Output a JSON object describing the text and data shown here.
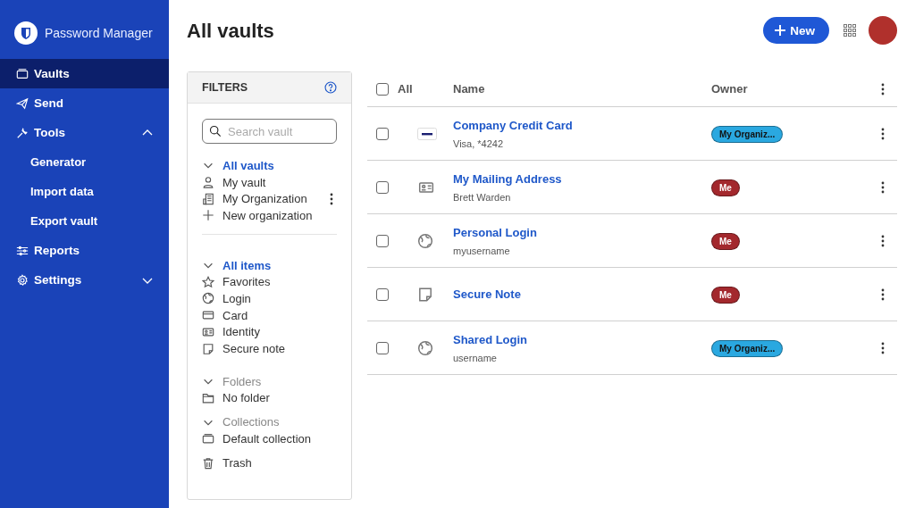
{
  "app": {
    "name": "Password Manager"
  },
  "nav": [
    {
      "label": "Vaults",
      "kind": "link",
      "selected": true
    },
    {
      "label": "Send",
      "kind": "link",
      "selected": false
    },
    {
      "label": "Tools",
      "kind": "group",
      "selected": false,
      "expanded": true,
      "children": [
        {
          "label": "Generator"
        },
        {
          "label": "Import data"
        },
        {
          "label": "Export vault"
        }
      ]
    },
    {
      "label": "Reports",
      "kind": "link",
      "selected": false
    },
    {
      "label": "Settings",
      "kind": "group",
      "selected": false,
      "expanded": false
    }
  ],
  "page": {
    "title": "All vaults",
    "new_button": "New"
  },
  "filters": {
    "title": "FILTERS",
    "search": {
      "placeholder": "Search vault"
    },
    "groups": [
      {
        "heading": "All vaults",
        "selected": true,
        "expanded": true,
        "items": [
          {
            "label": "My vault",
            "menu": false
          },
          {
            "label": "My Organization",
            "menu": true
          },
          {
            "label": "New organization",
            "menu": false
          }
        ]
      },
      {
        "heading": "All items",
        "selected": true,
        "expanded": true,
        "items": [
          {
            "label": "Favorites"
          },
          {
            "label": "Login"
          },
          {
            "label": "Card"
          },
          {
            "label": "Identity"
          },
          {
            "label": "Secure note"
          }
        ]
      },
      {
        "heading": "Folders",
        "selected": false,
        "expanded": true,
        "items": [
          {
            "label": "No folder"
          }
        ]
      },
      {
        "heading": "Collections",
        "selected": false,
        "expanded": true,
        "items": [
          {
            "label": "Default collection"
          }
        ]
      }
    ],
    "trash": "Trash"
  },
  "table": {
    "columns": [
      "All",
      "Name",
      "Owner"
    ],
    "all_checked": false,
    "rows": [
      {
        "kind": "card",
        "name": "Company Credit Card",
        "subtitle": "Visa, *4242",
        "owner": "My Organiz...",
        "color": "#2aa8e0",
        "checked": false
      },
      {
        "kind": "identity",
        "name": "My Mailing Address",
        "subtitle": "Brett Warden",
        "owner": "Me",
        "color": "#a3282d",
        "checked": false
      },
      {
        "kind": "login",
        "name": "Personal Login",
        "subtitle": "myusername",
        "owner": "Me",
        "color": "#a3282d",
        "checked": false
      },
      {
        "kind": "note",
        "name": "Secure Note",
        "owner": "Me",
        "color": "#a3282d",
        "checked": false
      },
      {
        "kind": "login",
        "name": "Shared Login",
        "subtitle": "username",
        "owner": "My Organiz...",
        "color": "#2aa8e0",
        "checked": false
      }
    ]
  }
}
